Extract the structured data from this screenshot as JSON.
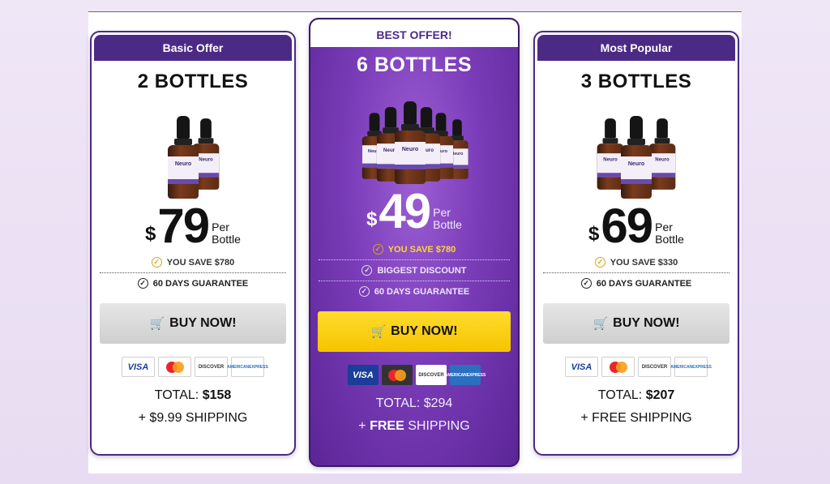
{
  "offers": [
    {
      "header": "Basic Offer",
      "title": "2 BOTTLES",
      "bottle_count_shown": 2,
      "currency": "$",
      "price": "79",
      "per_line1": "Per",
      "per_line2": "Bottle",
      "save_text": "YOU SAVE $780",
      "guarantee": "60 DAYS GUARANTEE",
      "buy_label": "BUY NOW!",
      "total_label": "TOTAL:",
      "total_value": "$158",
      "shipping_prefix": "+",
      "shipping_text": "$9.99 SHIPPING"
    },
    {
      "header": "BEST OFFER!",
      "title": "6 BOTTLES",
      "bottle_count_shown": 6,
      "currency": "$",
      "price": "49",
      "per_line1": "Per",
      "per_line2": "Bottle",
      "save_text": "YOU SAVE $780",
      "discount": "BIGGEST DISCOUNT",
      "guarantee": "60 DAYS GUARANTEE",
      "buy_label": "BUY NOW!",
      "total_label": "TOTAL:",
      "total_value": "$294",
      "shipping_prefix": "+",
      "shipping_free": "FREE",
      "shipping_text": "SHIPPING"
    },
    {
      "header": "Most Popular",
      "title": "3 BOTTLES",
      "bottle_count_shown": 3,
      "currency": "$",
      "price": "69",
      "per_line1": "Per",
      "per_line2": "Bottle",
      "save_text": "YOU SAVE $330",
      "guarantee": "60 DAYS GUARANTEE",
      "buy_label": "BUY NOW!",
      "total_label": "TOTAL:",
      "total_value": "$207",
      "shipping_prefix": "+",
      "shipping_text": "FREE SHIPPING"
    }
  ],
  "payment_cards": {
    "visa": "VISA",
    "discover": "DISCOVER",
    "amex_line1": "AMERICAN",
    "amex_line2": "EXPRESS"
  },
  "product_label": "Neuro",
  "icons": {
    "check": "check-circle-icon",
    "cart": "shopping-cart-icon"
  },
  "colors": {
    "brand_purple": "#4b2a86",
    "best_gradient_center": "#9d5fd4",
    "buy_yellow": "#f5c400",
    "buy_gray": "#cfcfcf",
    "save_gold": "#ffd633"
  }
}
